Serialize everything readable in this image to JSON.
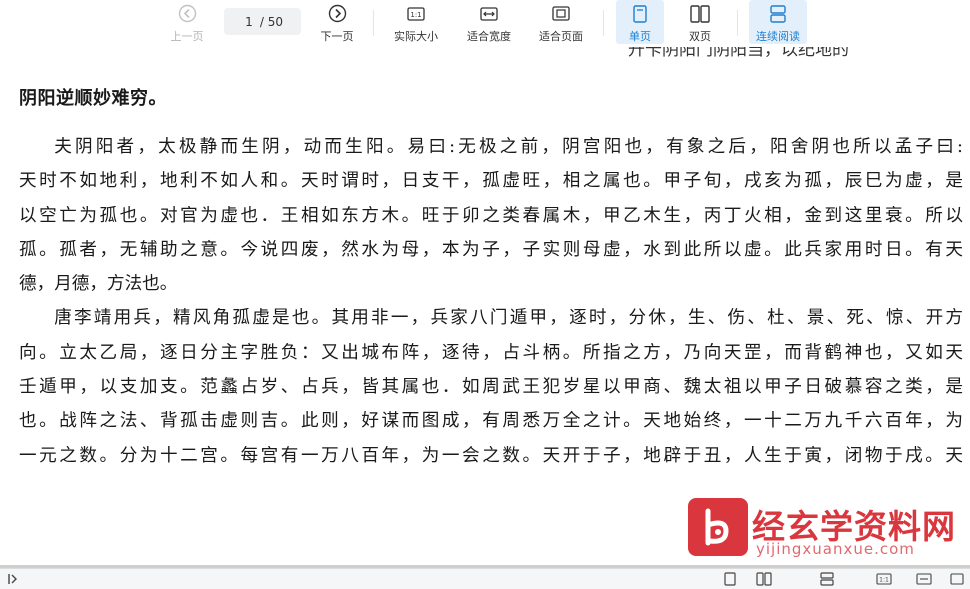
{
  "toolbar": {
    "prev_label": "上一页",
    "next_label": "下一页",
    "page_current": "1",
    "page_total": "/ 50",
    "actual_size_label": "实际大小",
    "fit_width_label": "适合宽度",
    "fit_page_label": "适合页面",
    "single_label": "单页",
    "double_label": "双页",
    "continuous_label": "连续阅读",
    "active_color": "#1e7fd0"
  },
  "document": {
    "top_cut_text": "升卡阴阳门阴阳当，以纪地的",
    "heading": "阴阳逆顺妙难穷。",
    "p1_lines": [
      "夫阴阳者，太极静而生阴，动而生阳。易曰:无极之前，阴宫阳也，有象之后，阳舍阴也所以孟子曰:",
      "天时不如地利，地利不如人和。天时谓时，日支干，孤虚旺，相之属也。甲子旬，戌亥为孤，辰巳为虚，是",
      "以空亡为孤也。对官为虚也．王相如东方木。旺于卯之类春属木，甲乙木生，丙丁火相，金到这里衰。所以",
      "孤。孤者，无辅助之意。今说四废，然水为母，本为子，子实则母虚，水到此所以虚。此兵家用时日。有天",
      "德，月德，方法也。"
    ],
    "p2_lines": [
      "唐李靖用兵，精风角孤虚是也。其用非一，兵家八门遁甲，逐时，分休，生、伤、杜、景、死、惊、开方",
      "向。立太乙局，逐日分主字胜负：又出城布阵，逐待，占斗柄。所指之方，乃向天罡，而背鹤神也，又如天",
      "壬遁甲，以支加支。范蠡占岁、占兵，皆其属也．如周武王犯岁星以甲商、魏太祖以甲子日破慕容之类，是",
      "也。战阵之法、背孤击虚则吉。此则，好谋而图成，有周悉万全之计。天地始终，一十二万九千六百年，为",
      "一元之数。分为十二宫。每宫有一万八百年，为一会之数。天开于子，地辟于丑，人生于寅，闭物于戌。天"
    ]
  },
  "watermark": {
    "title": "经玄学资料网",
    "url": "yijingxuanxue.com",
    "color": "#d9363e"
  }
}
